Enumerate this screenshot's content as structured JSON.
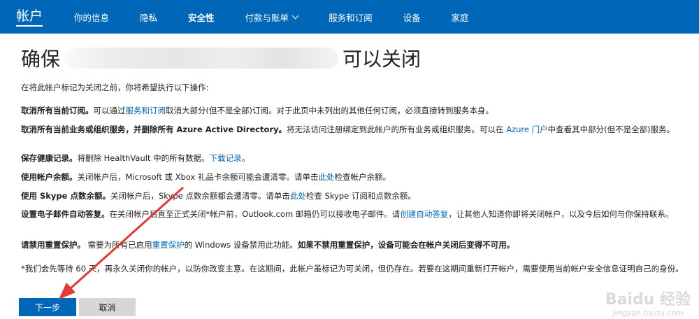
{
  "nav": {
    "brand": "帐户",
    "items": [
      "你的信息",
      "隐私",
      "安全性",
      "付款与账单",
      "服务和订阅",
      "设备",
      "家庭"
    ]
  },
  "title": {
    "prefix": "确保",
    "suffix": "可以关闭"
  },
  "intro": "在将此帐户标记为关闭之前，你将希望执行以下操作:",
  "items": {
    "i1_bold": "取消所有当前订阅。",
    "i1_a": "可以通过",
    "i1_link": "服务和订阅",
    "i1_b": "取消大部分(但不是全部)订阅。对于此页中未列出的其他任何订阅，必须直接转到服务本身。",
    "i2_bold": "取消所有当前业务或组织服务，并删除所有 Azure Active Directory。",
    "i2_a": "将无法访问注册绑定到此帐户的所有业务或组织服务。可以在 ",
    "i2_link": "Azure 门户",
    "i2_b": "中查看其中部分(但不是全部)服务。",
    "i3_bold": "保存健康记录。",
    "i3_a": "将删除 HealthVault 中的所有数据。",
    "i3_link": "下载记录",
    "i3_b": "。",
    "i4_bold": "使用帐户余额。",
    "i4_a": "关闭帐户后，Microsoft 或 Xbox 礼品卡余额可能会遭清零。请单击",
    "i4_link": "此处",
    "i4_b": "检查帐户余额。",
    "i5_bold": "使用 Skype 点数余额。",
    "i5_a": "关闭帐户后，Skype 点数余额都会遭清零。请单击",
    "i5_link": "此处",
    "i5_b": "检查 Skype 订阅和点数余额。",
    "i6_bold": "设置电子邮件自动答复。",
    "i6_a": "在关闭帐户后直至正式关闭*帐户前，Outlook.com 邮箱仍可以接收电子邮件。请",
    "i6_link": "创建自动答复",
    "i6_b": "，让其他人知道你即将关闭帐户，以及今后如何与你保持联系。",
    "i7_bold": "请禁用重置保护。",
    "i7_a": "需要为所有已启用",
    "i7_link": "重置保护",
    "i7_b": "的 Windows 设备禁用此功能。",
    "i7_bold2": "如果不禁用重置保护，设备可能会在帐户关闭后变得不可用。"
  },
  "footnote": "*我们会先等待 60 天，再永久关闭你的帐户，以防你改变主意。在这期间，此帐户虽标记为可关闭，但仍存在。若要在这期间重新打开帐户，需要使用当前帐户安全信息证明自己的身份。",
  "buttons": {
    "next": "下一步",
    "cancel": "取消"
  },
  "watermark": {
    "main": "Baidu 经验",
    "sub": "jingyan.baidu.com"
  },
  "colors": {
    "nav_bg": "#0067b8",
    "link": "#0067b8",
    "primary_button": "#0067b8",
    "secondary_button": "#d6d6d6",
    "arrow": "#e53935"
  }
}
